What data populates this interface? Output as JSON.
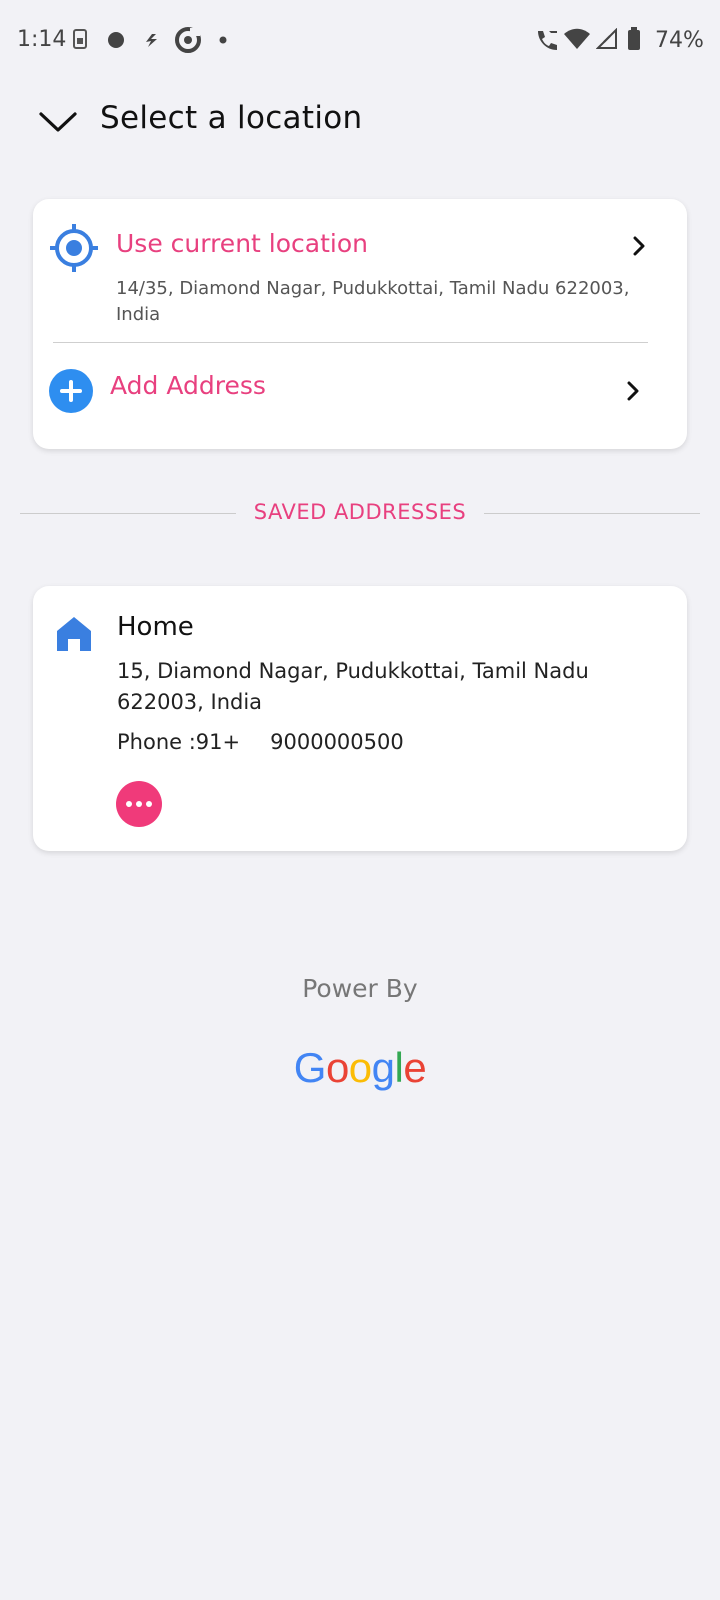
{
  "status_bar": {
    "time": "1:14",
    "battery_percent": "74%",
    "icons": [
      "sim-icon",
      "dot-icon",
      "flash-icon",
      "refresh-icon",
      "small-dot-icon",
      "wifi-calling-icon",
      "wifi-icon",
      "signal-icon",
      "battery-icon"
    ]
  },
  "header": {
    "back_icon": "chevron-down-icon",
    "title": "Select a location"
  },
  "current_location": {
    "icon": "crosshair-location-icon",
    "title": "Use current location",
    "address": "14/35, Diamond Nagar, Pudukkottai, Tamil Nadu 622003, India"
  },
  "add_address": {
    "icon": "plus-circle-icon",
    "label": "Add Address"
  },
  "saved_section": {
    "label": "SAVED ADDRESSES"
  },
  "saved_addresses": [
    {
      "icon": "home-icon",
      "title": "Home",
      "address": "15, Diamond Nagar, Pudukkottai, Tamil Nadu 622003, India",
      "phone_label": "Phone :91+",
      "phone_number": "9000000500"
    }
  ],
  "footer": {
    "powered_label": "Power By",
    "logo_text": "Google"
  },
  "colors": {
    "accent": "#e8407f",
    "blue": "#2e8ef0",
    "background": "#f2f2f6"
  }
}
